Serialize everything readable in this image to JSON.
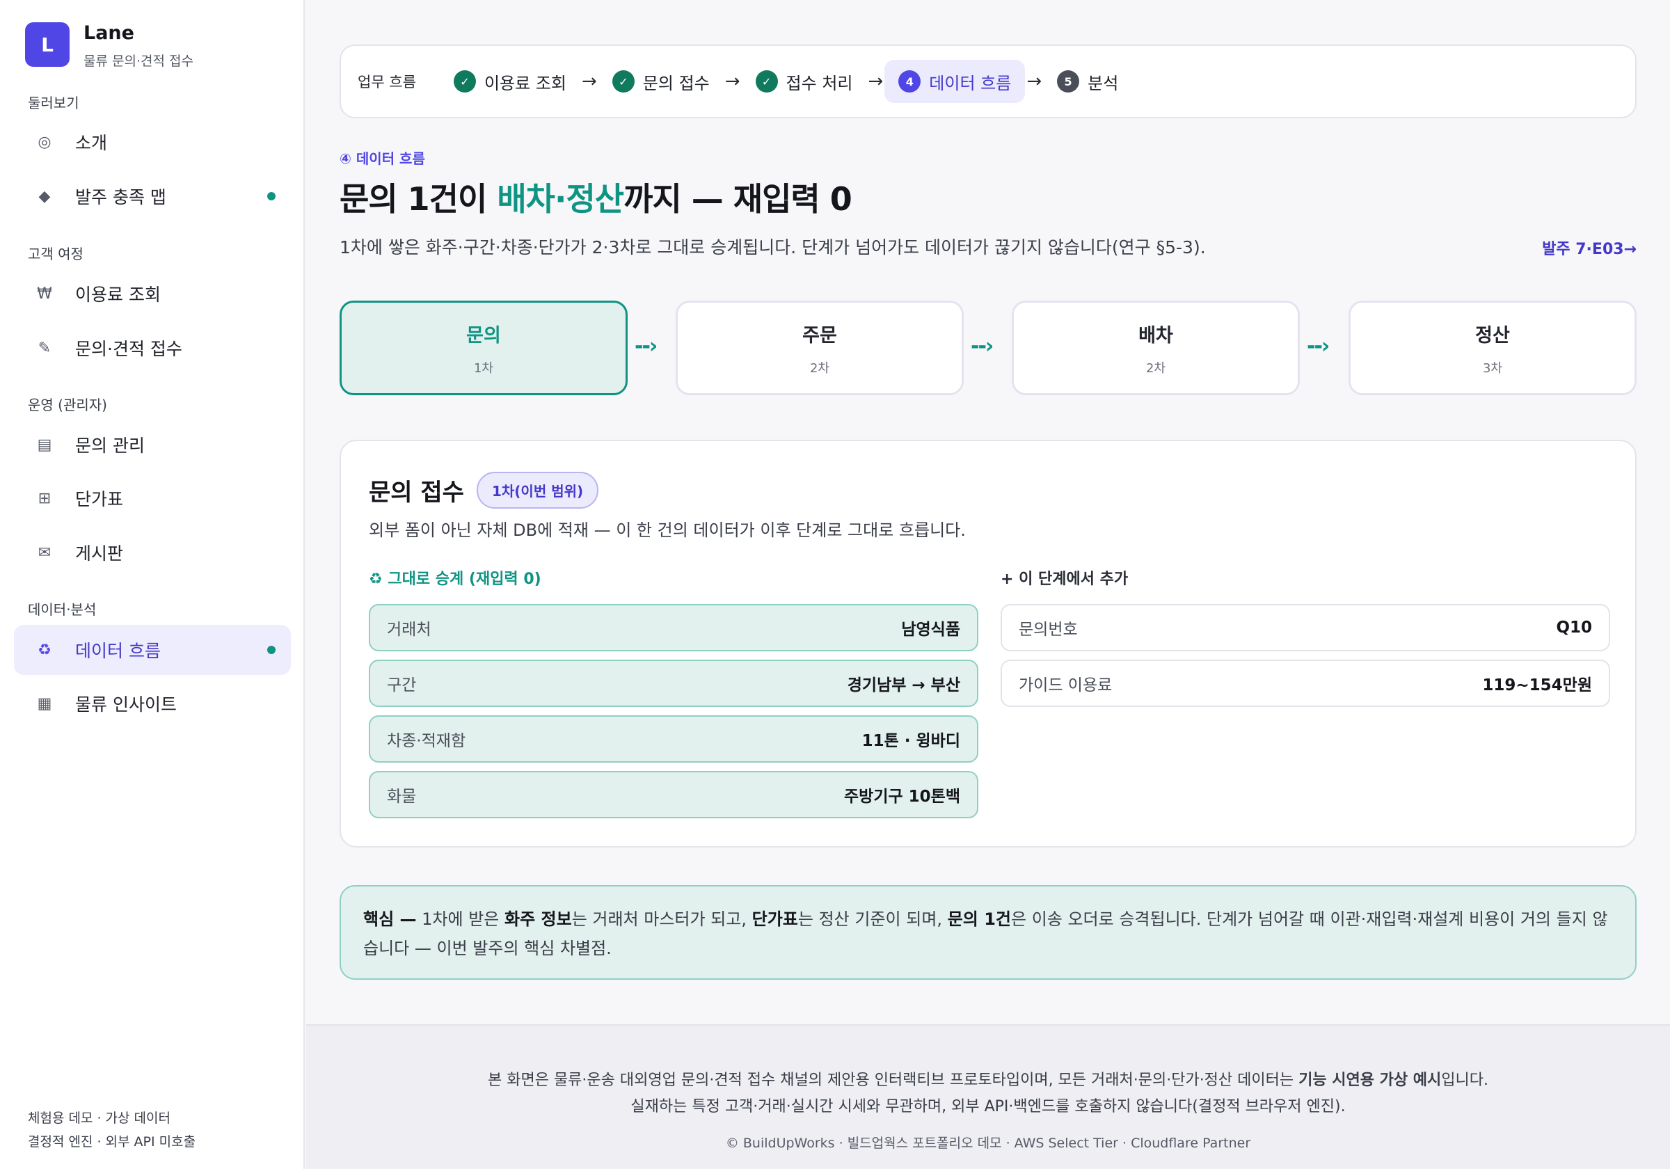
{
  "brand": {
    "logo_letter": "L",
    "name": "Lane",
    "subtitle": "물류 문의·견적 접수"
  },
  "sidebar": {
    "sections": [
      {
        "label": "둘러보기"
      },
      {
        "label": "고객 여정"
      },
      {
        "label": "운영 (관리자)"
      },
      {
        "label": "데이터·분석"
      }
    ],
    "items": [
      {
        "label": "소개",
        "icon": "target-icon",
        "glyph": "◎"
      },
      {
        "label": "발주 충족 맵",
        "icon": "diamond-icon",
        "glyph": "◆"
      },
      {
        "label": "이용료 조회",
        "icon": "won-icon",
        "glyph": "₩"
      },
      {
        "label": "문의·견적 접수",
        "icon": "pencil-icon",
        "glyph": "✎"
      },
      {
        "label": "문의 관리",
        "icon": "list-icon",
        "glyph": "▤"
      },
      {
        "label": "단가표",
        "icon": "grid-icon",
        "glyph": "⊞"
      },
      {
        "label": "게시판",
        "icon": "mail-icon",
        "glyph": "✉"
      },
      {
        "label": "데이터 흐름",
        "icon": "recycle-icon",
        "glyph": "♻"
      },
      {
        "label": "물류 인사이트",
        "icon": "chart-icon",
        "glyph": "▦"
      }
    ],
    "footer": [
      "체험용 데모 · 가상 데이터",
      "결정적 엔진 · 외부 API 미호출"
    ]
  },
  "stepper": {
    "label": "업무 흐름",
    "steps": [
      {
        "mark": "✓",
        "label": "이용료 조회",
        "state": "done"
      },
      {
        "mark": "✓",
        "label": "문의 접수",
        "state": "done"
      },
      {
        "mark": "✓",
        "label": "접수 처리",
        "state": "done"
      },
      {
        "mark": "4",
        "label": "데이터 흐름",
        "state": "current"
      },
      {
        "mark": "5",
        "label": "분석",
        "state": "todo"
      }
    ],
    "arrow": "→"
  },
  "page": {
    "eyebrow": "④ 데이터 흐름",
    "title_pre": "문의 1건이 ",
    "title_hl": "배차·정산",
    "title_post": "까지 — 재입력 0",
    "description": "1차에 쌓은 화주·구간·차종·단가가 2·3차로 그대로 승계됩니다. 단계가 넘어가도 데이터가 끊기지 않습니다(연구 §5-3).",
    "order_link": "발주 7·E03→"
  },
  "flow": [
    {
      "title": "문의",
      "phase": "1차"
    },
    {
      "title": "주문",
      "phase": "2차"
    },
    {
      "title": "배차",
      "phase": "2차"
    },
    {
      "title": "정산",
      "phase": "3차"
    }
  ],
  "card": {
    "title": "문의 접수",
    "badge": "1차(이번 범위)",
    "description": "외부 폼이 아닌 자체 DB에 적재 — 이 한 건의 데이터가 이후 단계로 그대로 흐릅니다.",
    "inherit_head": "♻  그대로 승계 (재입력 0)",
    "add_head": "+  이 단계에서 추가",
    "inherited": [
      {
        "k": "거래처",
        "v": "남영식품"
      },
      {
        "k": "구간",
        "v": "경기남부 → 부산"
      },
      {
        "k": "차종·적재함",
        "v": "11톤 · 윙바디"
      },
      {
        "k": "화물",
        "v": "주방기구 10톤백"
      }
    ],
    "added": [
      {
        "k": "문의번호",
        "v": "Q10"
      },
      {
        "k": "가이드 이용료",
        "v": "119~154만원"
      }
    ]
  },
  "key": {
    "lead": "핵심 —",
    "t1": " 1차에 받은 ",
    "b1": "화주 정보",
    "t2": "는 거래처 마스터가 되고, ",
    "b2": "단가표",
    "t3": "는 정산 기준이 되며, ",
    "b3": "문의 1건",
    "t4": "은 이송 오더로 승격됩니다. 단계가 넘어갈 때 이관·재입력·재설계 비용이 거의 들지 않습니다 — 이번 발주의 핵심 차별점."
  },
  "footer": {
    "line1_pre": "본 화면은 물류·운송 대외영업 문의·견적 접수 채널의 제안용 인터랙티브 프로토타입이며, 모든 거래처·문의·단가·정산 데이터는 ",
    "line1_bold": "기능 시연용 가상 예시",
    "line1_post": "입니다.",
    "line2": "실재하는 특정 고객·거래·실시간 시세와 무관하며, 외부 API·백엔드를 호출하지 않습니다(결정적 브라우저 엔진).",
    "line3": "© BuildUpWorks · 빌드업웍스 포트폴리오 데모 · AWS Select Tier · Cloudflare Partner"
  }
}
